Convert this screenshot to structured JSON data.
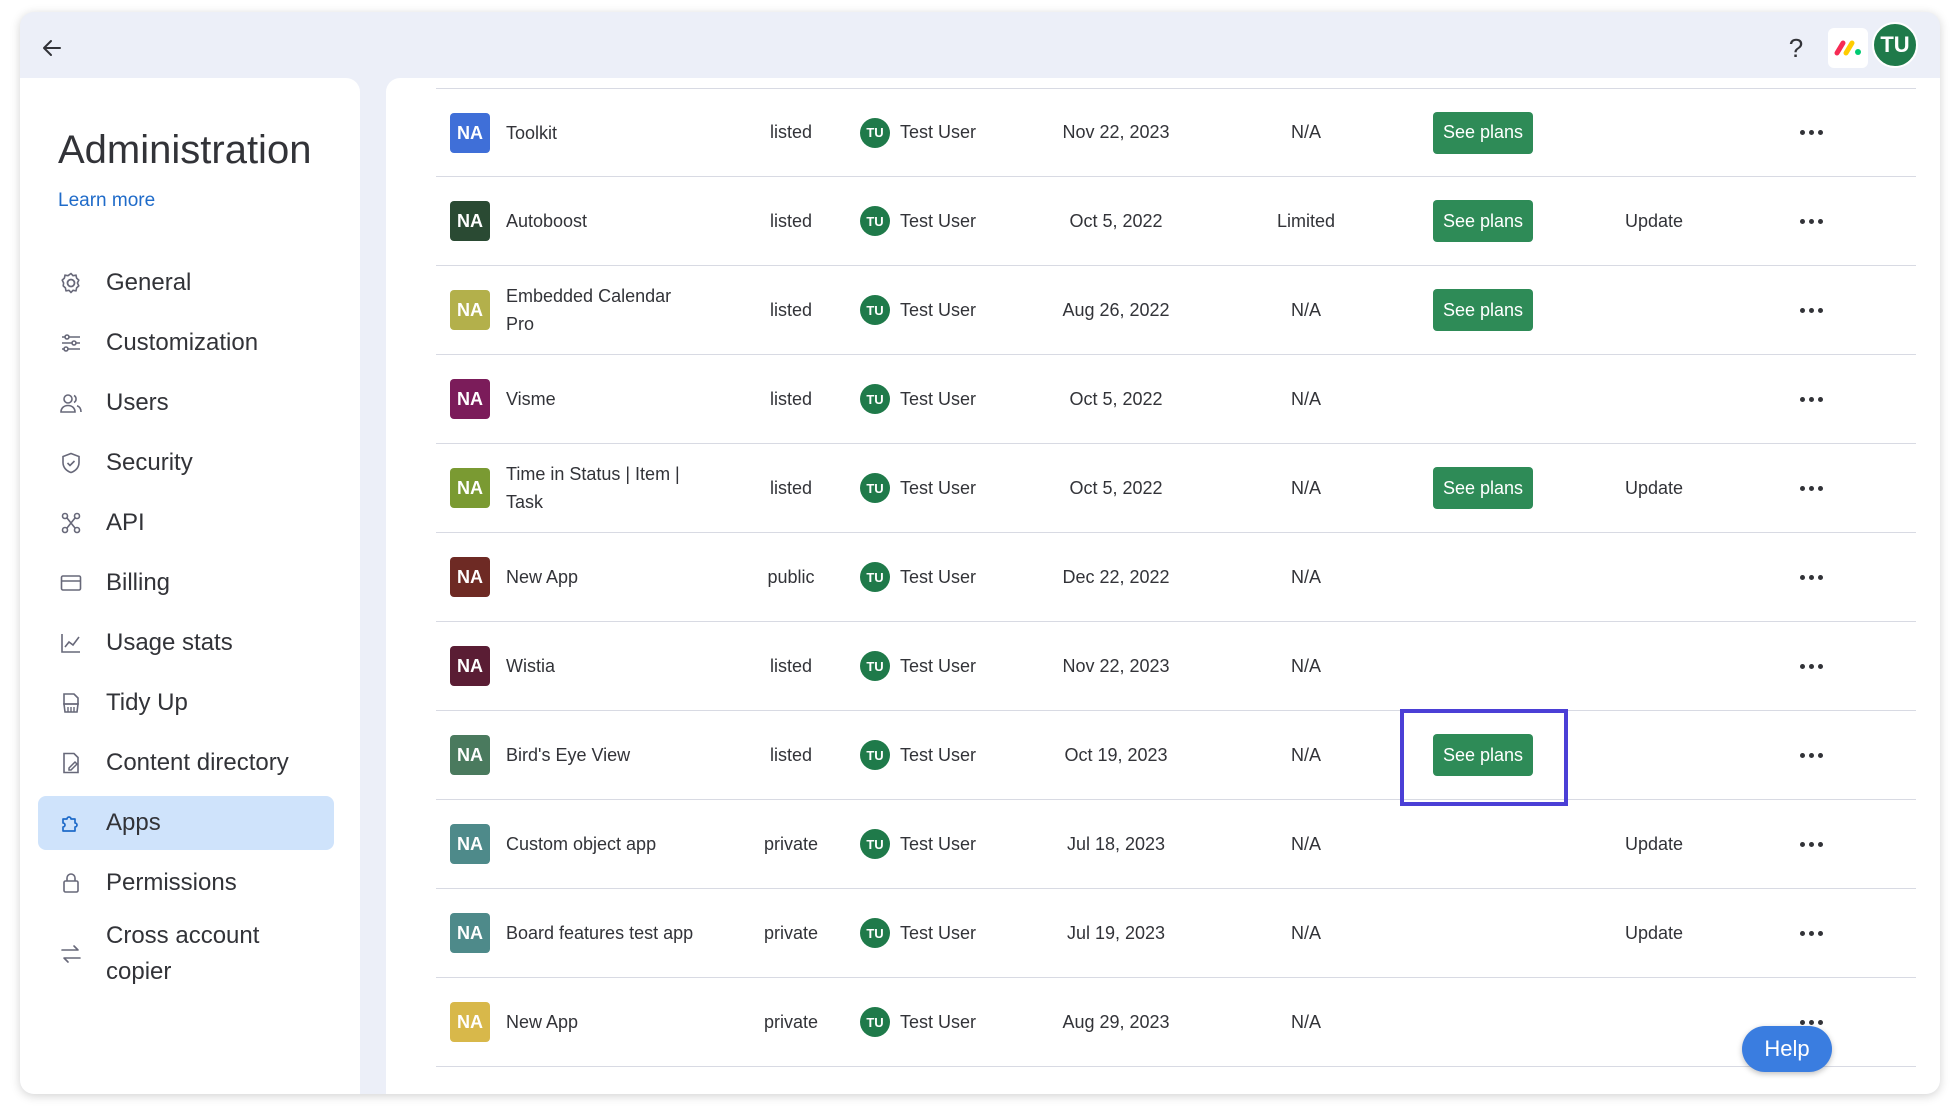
{
  "topbar": {
    "help_label": "?",
    "user_initials": "TU"
  },
  "sidebar": {
    "title": "Administration",
    "learn_more": "Learn more",
    "items": [
      {
        "label": "General",
        "icon": "gear-icon"
      },
      {
        "label": "Customization",
        "icon": "sliders-icon"
      },
      {
        "label": "Users",
        "icon": "users-icon"
      },
      {
        "label": "Security",
        "icon": "shield-icon"
      },
      {
        "label": "API",
        "icon": "api-icon"
      },
      {
        "label": "Billing",
        "icon": "card-icon"
      },
      {
        "label": "Usage stats",
        "icon": "chart-icon"
      },
      {
        "label": "Tidy Up",
        "icon": "broom-icon"
      },
      {
        "label": "Content directory",
        "icon": "document-icon"
      },
      {
        "label": "Apps",
        "icon": "puzzle-icon",
        "active": true
      },
      {
        "label": "Permissions",
        "icon": "lock-icon"
      },
      {
        "label": "Cross account copier",
        "icon": "transfer-icon"
      }
    ]
  },
  "apps": [
    {
      "badge": "NA",
      "color": "#3f6fd8",
      "name": "Toolkit",
      "visibility": "listed",
      "owner": "Test User",
      "owner_initials": "TU",
      "date": "Nov 22, 2023",
      "status": "N/A",
      "see_plans": "See plans",
      "update": ""
    },
    {
      "badge": "NA",
      "color": "#2a4a33",
      "name": "Autoboost",
      "visibility": "listed",
      "owner": "Test User",
      "owner_initials": "TU",
      "date": "Oct 5, 2022",
      "status": "Limited",
      "see_plans": "See plans",
      "update": "Update"
    },
    {
      "badge": "NA",
      "color": "#b3b04b",
      "name": "Embedded Calendar Pro",
      "visibility": "listed",
      "owner": "Test User",
      "owner_initials": "TU",
      "date": "Aug 26, 2022",
      "status": "N/A",
      "see_plans": "See plans",
      "update": ""
    },
    {
      "badge": "NA",
      "color": "#7b1c5a",
      "name": "Visme",
      "visibility": "listed",
      "owner": "Test User",
      "owner_initials": "TU",
      "date": "Oct 5, 2022",
      "status": "N/A",
      "see_plans": "",
      "update": ""
    },
    {
      "badge": "NA",
      "color": "#7a9a32",
      "name": "Time in Status | Item | Task",
      "visibility": "listed",
      "owner": "Test User",
      "owner_initials": "TU",
      "date": "Oct 5, 2022",
      "status": "N/A",
      "see_plans": "See plans",
      "update": "Update"
    },
    {
      "badge": "NA",
      "color": "#6e2a24",
      "name": "New App",
      "visibility": "public",
      "owner": "Test User",
      "owner_initials": "TU",
      "date": "Dec 22, 2022",
      "status": "N/A",
      "see_plans": "",
      "update": ""
    },
    {
      "badge": "NA",
      "color": "#5a1d34",
      "name": "Wistia",
      "visibility": "listed",
      "owner": "Test User",
      "owner_initials": "TU",
      "date": "Nov 22, 2023",
      "status": "N/A",
      "see_plans": "",
      "update": ""
    },
    {
      "badge": "NA",
      "color": "#4a7a5e",
      "name": "Bird's Eye View",
      "visibility": "listed",
      "owner": "Test User",
      "owner_initials": "TU",
      "date": "Oct 19, 2023",
      "status": "N/A",
      "see_plans": "See plans",
      "update": "",
      "highlighted": true
    },
    {
      "badge": "NA",
      "color": "#4e8a8a",
      "name": "Custom object app",
      "visibility": "private",
      "owner": "Test User",
      "owner_initials": "TU",
      "date": "Jul 18, 2023",
      "status": "N/A",
      "see_plans": "",
      "update": "Update"
    },
    {
      "badge": "NA",
      "color": "#4e8a8a",
      "name": "Board features test app",
      "visibility": "private",
      "owner": "Test User",
      "owner_initials": "TU",
      "date": "Jul 19, 2023",
      "status": "N/A",
      "see_plans": "",
      "update": "Update"
    },
    {
      "badge": "NA",
      "color": "#d8b84a",
      "name": "New App",
      "visibility": "private",
      "owner": "Test User",
      "owner_initials": "TU",
      "date": "Aug 29, 2023",
      "status": "N/A",
      "see_plans": "",
      "update": ""
    }
  ],
  "help_button": "Help"
}
